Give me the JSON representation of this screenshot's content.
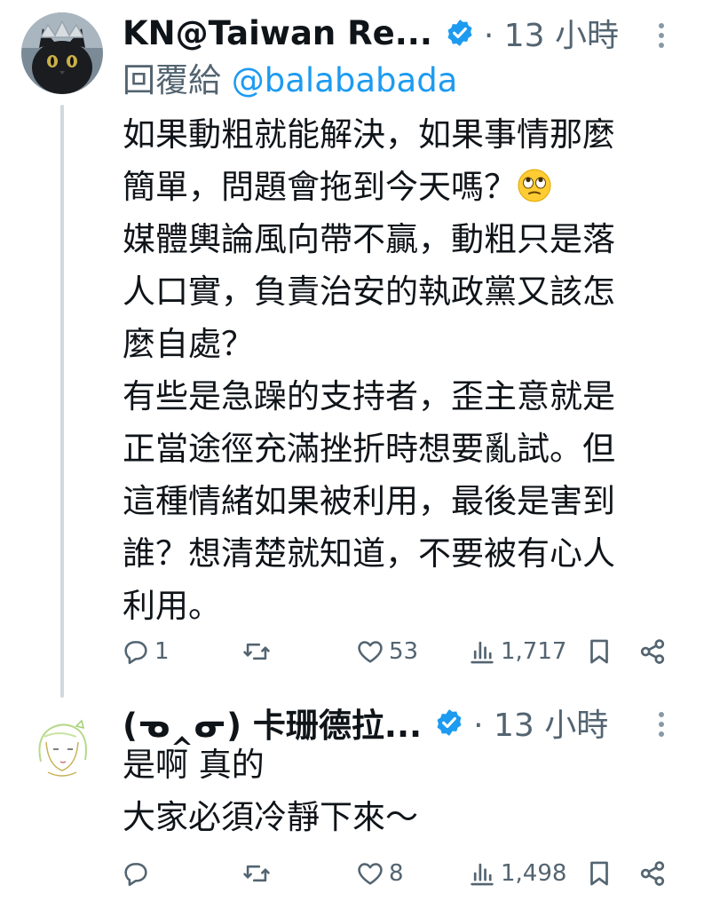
{
  "posts": [
    {
      "author": "KN@Taiwan Re...",
      "meta": "· 13 小時",
      "reply_to_prefix": "回覆給",
      "reply_to_handle": "@balababada",
      "lines": [
        "如果動粗就能解決，如果事情那麼",
        "簡單，問題會拖到今天嗎？",
        "媒體輿論風向帶不贏，動粗只是落",
        "人口實，負責治安的執政黨又該怎",
        "麼自處？",
        "有些是急躁的支持者，歪主意就是",
        "正當途徑充滿挫折時想要亂試。但",
        "這種情緒如果被利用，最後是害到",
        "誰？想清楚就知道，不要被有心人",
        "利用。"
      ],
      "emoji": "face-with-rolling-eyes",
      "stats": {
        "replies": "1",
        "reposts": "",
        "likes": "53",
        "views": "1,717"
      }
    },
    {
      "author": "(ᓀ‸ᓂ) 卡珊德拉...",
      "meta": "· 13 小時",
      "lines": [
        "是啊 真的",
        "大家必須冷靜下來～"
      ],
      "stats": {
        "replies": "",
        "reposts": "",
        "likes": "8",
        "views": "1,498"
      }
    }
  ],
  "colors": {
    "text": "#0f1419",
    "secondary": "#536471",
    "link": "#1d9bf0",
    "verified": "#1d9bf0",
    "thread_line": "#cfd9de"
  },
  "icons": [
    "reply-icon",
    "repost-icon",
    "like-icon",
    "views-icon",
    "bookmark-icon",
    "share-icon",
    "more-icon",
    "verified-badge-icon"
  ]
}
